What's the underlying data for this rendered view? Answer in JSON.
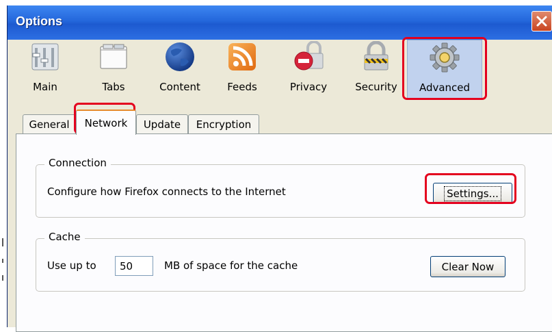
{
  "window": {
    "title": "Options"
  },
  "toolbar": {
    "panes": [
      {
        "label": "Main",
        "icon": "main-pane-icon"
      },
      {
        "label": "Tabs",
        "icon": "tabs-pane-icon"
      },
      {
        "label": "Content",
        "icon": "globe-icon"
      },
      {
        "label": "Feeds",
        "icon": "rss-feed-icon"
      },
      {
        "label": "Privacy",
        "icon": "no-entry-lock-icon"
      },
      {
        "label": "Security",
        "icon": "padlock-icon"
      },
      {
        "label": "Advanced",
        "icon": "gear-icon"
      }
    ],
    "selected": "Advanced"
  },
  "tabs": [
    "General",
    "Network",
    "Update",
    "Encryption"
  ],
  "active_tab": "Network",
  "connection": {
    "legend": "Connection",
    "description": "Configure how Firefox connects to the Internet",
    "settings_button": "Settings..."
  },
  "cache": {
    "legend": "Cache",
    "use_up_to_label": "Use up to",
    "size_value": "50",
    "size_suffix": "MB of space for the cache",
    "clear_button": "Clear Now"
  },
  "colors": {
    "titlebar": "#2467db",
    "highlight": "#e4001e",
    "dialog_bg": "#ece9d8",
    "panel_bg": "#fcfcfe"
  }
}
